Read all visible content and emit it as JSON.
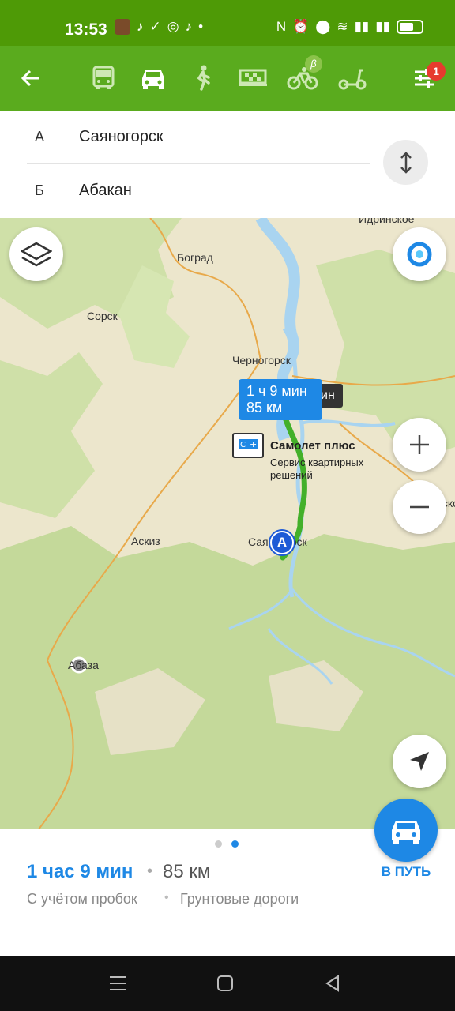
{
  "status": {
    "time": "13:53"
  },
  "toolbar": {
    "back_icon": "arrow-left-icon",
    "modes": [
      "bus",
      "car",
      "walk",
      "taxi",
      "bicycle",
      "scooter"
    ],
    "active_mode": "car",
    "bicycle_badge": "β",
    "settings_badge": "1"
  },
  "route": {
    "from_letter": "А",
    "from": "Саяногорск",
    "to_letter": "Б",
    "to": "Абакан"
  },
  "map": {
    "labels": {
      "bograd": "Боград",
      "sorsk": "Сорск",
      "chernogorsk": "Черногорск",
      "idrinskoe": "Идринское",
      "askiz": "Аскиз",
      "sayanogorsk": "Саяногорск",
      "abaza": "Абаза",
      "ermakovskoe": "Ермаковское"
    },
    "route_bubble": {
      "time": "1 ч 9 мин",
      "distance": "85 км",
      "alt_suffix": "ин"
    },
    "pin_a": "А",
    "poi": {
      "name": "Самолет плюс",
      "subtitle": "Сервис квартирных решений"
    },
    "accent_route": "#43b02a",
    "accent_blue": "#1e88e5"
  },
  "summary": {
    "time": "1 час 9 мин",
    "separator": "•",
    "distance": "85 км",
    "note_traffic": "С учётом пробок",
    "note_roads": "Грунтовые дороги",
    "go_label": "В ПУТЬ"
  }
}
